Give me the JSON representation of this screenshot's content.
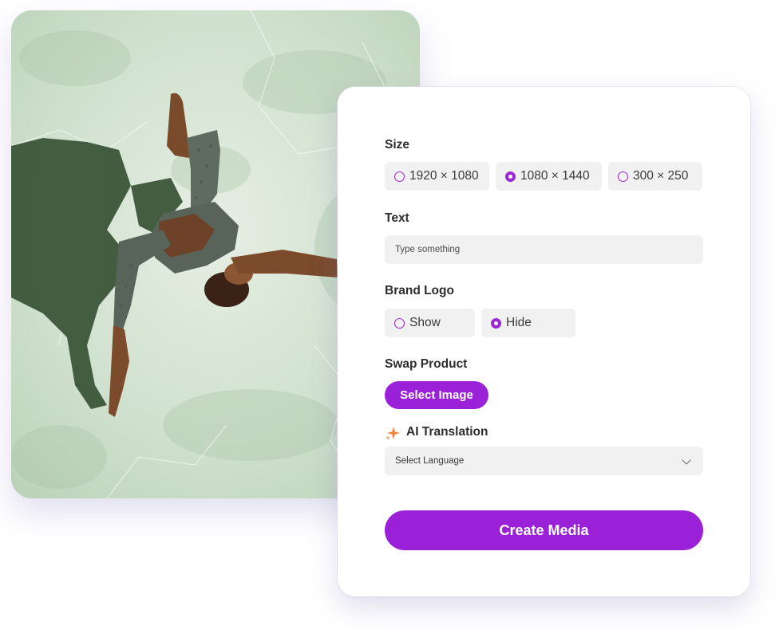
{
  "photo": {
    "description_icon": "yoga-photo-image"
  },
  "form": {
    "size": {
      "label": "Size",
      "options": [
        {
          "label": "1920 × 1080",
          "selected": false
        },
        {
          "label": "1080 × 1440",
          "selected": true
        },
        {
          "label": "300 × 250",
          "selected": false
        }
      ]
    },
    "text": {
      "label": "Text",
      "placeholder": "Type something"
    },
    "brand_logo": {
      "label": "Brand Logo",
      "options": [
        {
          "label": "Show",
          "selected": false
        },
        {
          "label": "Hide",
          "selected": true
        }
      ]
    },
    "swap_product": {
      "label": "Swap Product",
      "button_label": "Select Image"
    },
    "ai_translation": {
      "label": "AI Translation",
      "icon": "sparkle-icon",
      "select_placeholder": "Select Language"
    },
    "create_label": "Create Media"
  },
  "colors": {
    "accent": "#9b21d8",
    "chip_bg": "#f1f1f2",
    "sparkle": "#f0873a"
  }
}
